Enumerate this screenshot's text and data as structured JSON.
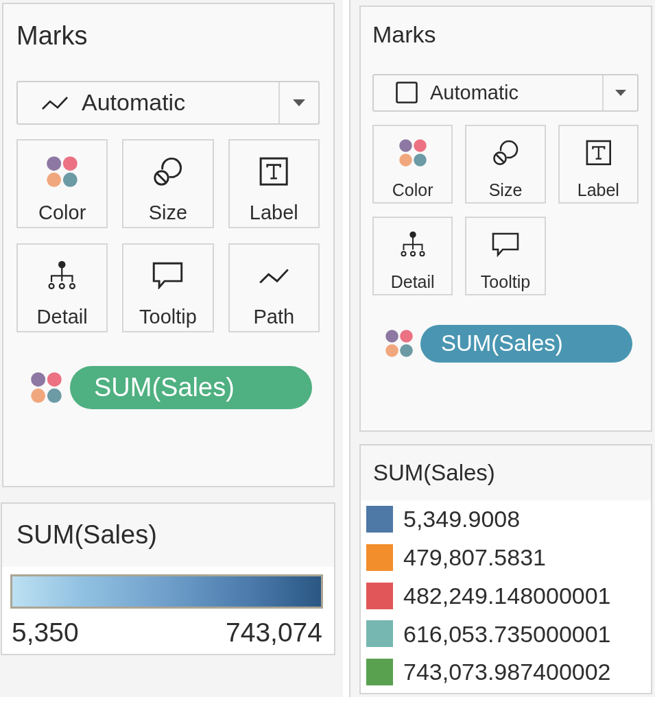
{
  "panes": [
    {
      "marks": {
        "title": "Marks",
        "mark_type": {
          "value": "Automatic",
          "kind": "line"
        },
        "cards": [
          {
            "label": "Color",
            "kind": "color"
          },
          {
            "label": "Size",
            "kind": "size"
          },
          {
            "label": "Label",
            "kind": "label"
          },
          {
            "label": "Detail",
            "kind": "detail"
          },
          {
            "label": "Tooltip",
            "kind": "tooltip"
          },
          {
            "label": "Path",
            "kind": "path"
          }
        ],
        "pill": {
          "field": "SUM(Sales)",
          "color": "#4fb081"
        }
      },
      "legend": {
        "kind": "gradient",
        "title": "SUM(Sales)",
        "min_label": "5,350",
        "max_label": "743,074"
      }
    },
    {
      "marks": {
        "title": "Marks",
        "mark_type": {
          "value": "Automatic",
          "kind": "square"
        },
        "cards": [
          {
            "label": "Color",
            "kind": "color"
          },
          {
            "label": "Size",
            "kind": "size"
          },
          {
            "label": "Label",
            "kind": "label"
          },
          {
            "label": "Detail",
            "kind": "detail"
          },
          {
            "label": "Tooltip",
            "kind": "tooltip"
          }
        ],
        "pill": {
          "field": "SUM(Sales)",
          "color": "#4a96b2"
        }
      },
      "legend": {
        "kind": "categorical",
        "title": "SUM(Sales)",
        "items": [
          {
            "label": "5,349.9008",
            "color": "#4e79a7"
          },
          {
            "label": "479,807.5831",
            "color": "#f28e2b"
          },
          {
            "label": "482,249.148000001",
            "color": "#e15759"
          },
          {
            "label": "616,053.735000001",
            "color": "#76b7b2"
          },
          {
            "label": "743,073.987400002",
            "color": "#59a14f"
          }
        ]
      }
    }
  ]
}
